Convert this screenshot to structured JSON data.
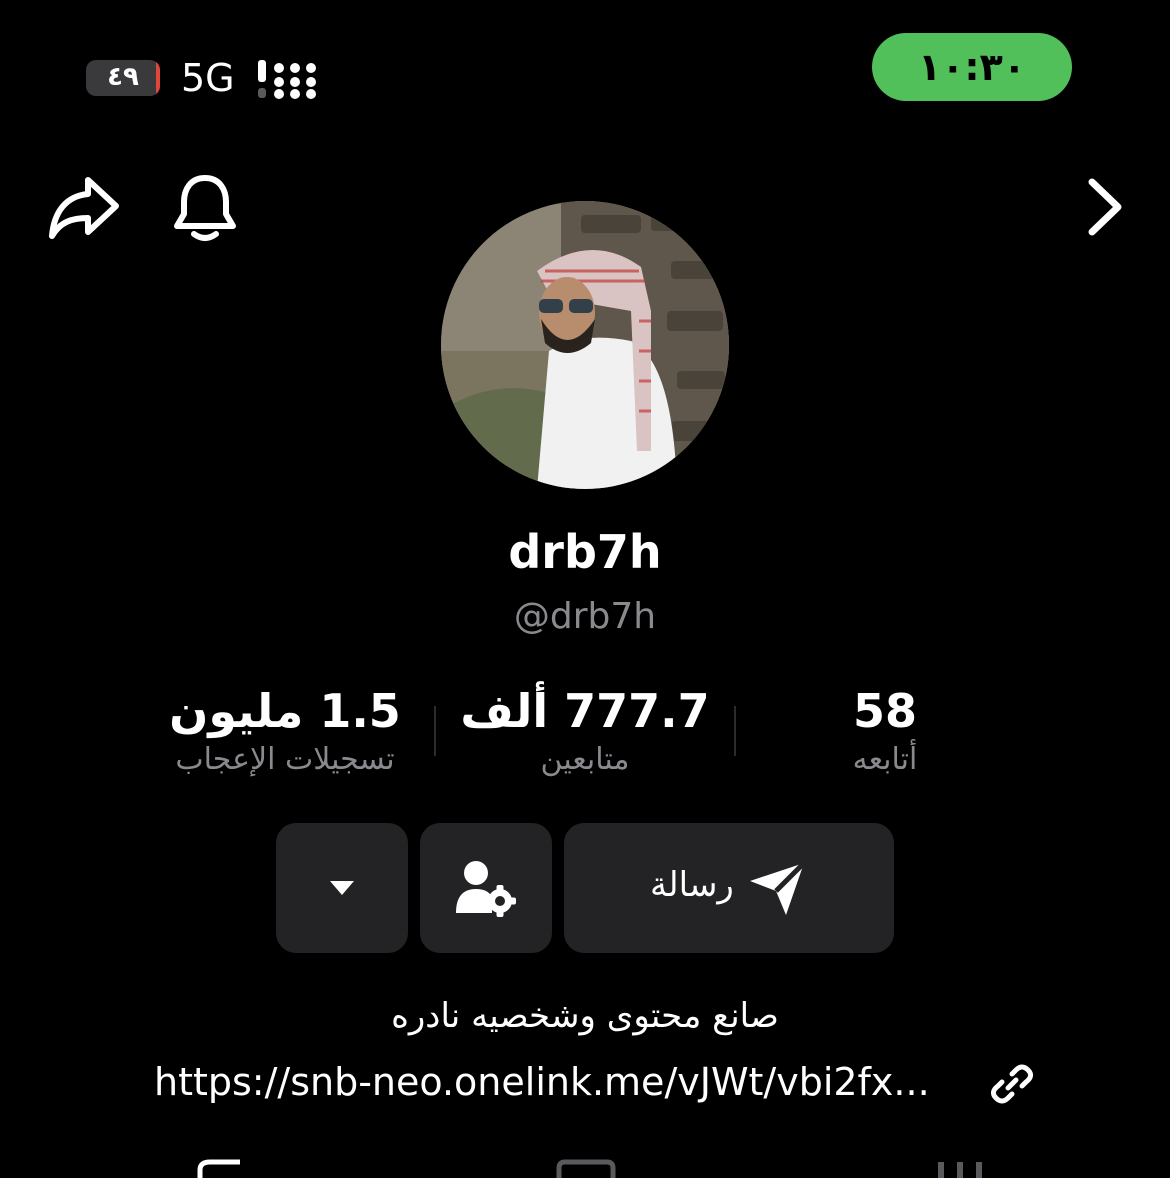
{
  "status_bar": {
    "battery_level": "٤٩",
    "battery_percent": 0.49,
    "battery_color": "#e0463c",
    "network": "5G",
    "time": "١٠:٣٠",
    "time_pill_color": "#52c05a"
  },
  "nav": {
    "share_icon": "share-arrow",
    "bell_icon": "bell",
    "back_icon": "chevron-right"
  },
  "profile": {
    "display_name": "drb7h",
    "handle": "@drb7h"
  },
  "stats": {
    "likes": {
      "value": "1.5 مليون",
      "label": "تسجيلات الإعجاب"
    },
    "followers": {
      "value": "777.7 ألف",
      "label": "متابعين"
    },
    "following": {
      "value": "58",
      "label": "أتابعه"
    }
  },
  "actions": {
    "message_label": "رسالة",
    "message_icon": "send",
    "settings_icon": "user-gear",
    "dropdown_icon": "caret-down"
  },
  "bio": "صانع محتوى وشخصيه نادره",
  "link": "https://snb-neo.onelink.me/vJWt/vbi2fx..."
}
